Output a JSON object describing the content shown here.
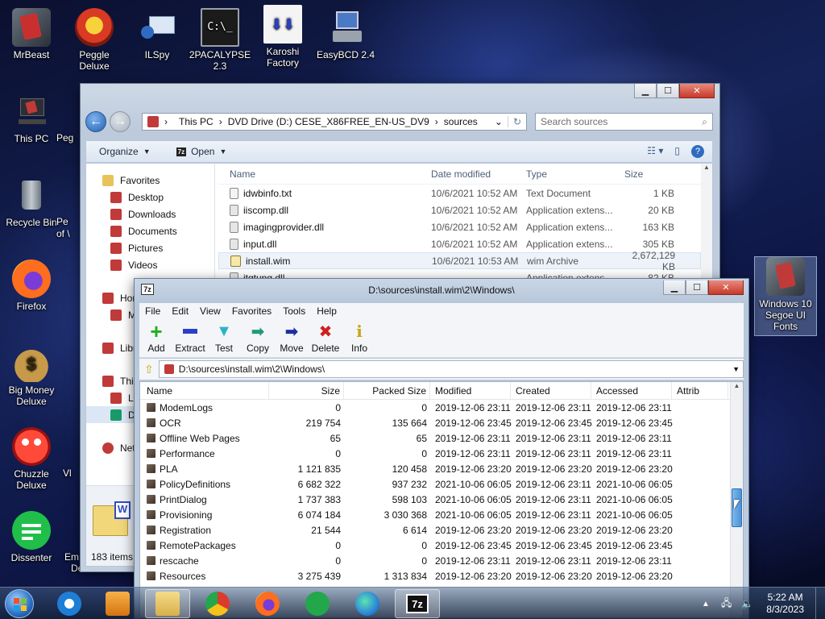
{
  "desktop_icons": [
    {
      "label": "MrBeast",
      "icon": "mrbeast-icon",
      "color": "#c83030"
    },
    {
      "label": "Peggle Deluxe",
      "icon": "peggle-icon",
      "color": "#d93a24"
    },
    {
      "label": "ILSpy",
      "icon": "ilspy-icon",
      "color": "#a9c4e3"
    },
    {
      "label": "2PACALYPSE 2.3",
      "icon": "terminal-icon",
      "color": "#222222"
    },
    {
      "label": "Karoshi Factory",
      "icon": "karoshi-icon",
      "color": "#f2f2f2"
    },
    {
      "label": "EasyBCD 2.4",
      "icon": "easybcd-icon",
      "color": "#4a79c6"
    },
    {
      "label": "This PC",
      "icon": "this-pc-icon",
      "color": "#c03a3a"
    },
    {
      "label": "Recycle Bin",
      "icon": "recycle-bin-icon",
      "color": "#9aa4ad"
    },
    {
      "label": "Firefox",
      "icon": "firefox-icon",
      "color": "#ff6d1f"
    },
    {
      "label": "Big Money Deluxe",
      "icon": "money-bag-icon",
      "color": "#b58a3a"
    },
    {
      "label": "Chuzzle Deluxe",
      "icon": "chuzzle-icon",
      "color": "#d8262a"
    },
    {
      "label": "Dissenter",
      "icon": "dissenter-icon",
      "color": "#1fbf4a"
    },
    {
      "label": "Windows 10 Segoe UI Fonts",
      "icon": "fonts-icon",
      "color": "#c03a3a"
    }
  ],
  "explorer": {
    "breadcrumb": [
      "This PC",
      "DVD Drive (D:) CESE_X86FREE_EN-US_DV9",
      "sources"
    ],
    "search_placeholder": "Search sources",
    "toolbar": {
      "organize": "Organize",
      "open": "Open"
    },
    "nav": {
      "favorites": "Favorites",
      "items": [
        "Desktop",
        "Downloads",
        "Documents",
        "Pictures",
        "Videos"
      ],
      "home_partial": "Hor",
      "m_partial": "M",
      "libraries_partial": "Libr",
      "this_pc_partial": "This",
      "lo_partial": "Lo",
      "d_partial": "D",
      "network_partial": "Net"
    },
    "columns": {
      "name": "Name",
      "date": "Date modified",
      "type": "Type",
      "size": "Size"
    },
    "files": [
      {
        "name": "idwbinfo.txt",
        "date": "10/6/2021 10:52 AM",
        "type": "Text Document",
        "size": "1 KB"
      },
      {
        "name": "iiscomp.dll",
        "date": "10/6/2021 10:52 AM",
        "type": "Application extens...",
        "size": "20 KB"
      },
      {
        "name": "imagingprovider.dll",
        "date": "10/6/2021 10:52 AM",
        "type": "Application extens...",
        "size": "163 KB"
      },
      {
        "name": "input.dll",
        "date": "10/6/2021 10:52 AM",
        "type": "Application extens...",
        "size": "305 KB"
      },
      {
        "name": "install.wim",
        "date": "10/6/2021 10:53 AM",
        "type": "wim Archive",
        "size": "2,672,129 KB"
      },
      {
        "name": "itgtung.dll",
        "date": "",
        "type": "Application extens...",
        "size": "82 KB"
      }
    ],
    "status": "183 items"
  },
  "sevenzip": {
    "title": "D:\\sources\\install.wim\\2\\Windows\\",
    "menu": [
      "File",
      "Edit",
      "View",
      "Favorites",
      "Tools",
      "Help"
    ],
    "toolbar": [
      {
        "label": "Add",
        "icon": "add-icon",
        "color": "#1fae1f"
      },
      {
        "label": "Extract",
        "icon": "extract-icon",
        "color": "#2b3ec9"
      },
      {
        "label": "Test",
        "icon": "test-icon",
        "color": "#28b4c8"
      },
      {
        "label": "Copy",
        "icon": "copy-icon",
        "color": "#1f9a7a"
      },
      {
        "label": "Move",
        "icon": "move-icon",
        "color": "#1e2f9e"
      },
      {
        "label": "Delete",
        "icon": "delete-icon",
        "color": "#d01f1f"
      },
      {
        "label": "Info",
        "icon": "info-icon",
        "color": "#c9a416"
      }
    ],
    "path": "D:\\sources\\install.wim\\2\\Windows\\",
    "columns": {
      "name": "Name",
      "size": "Size",
      "packed": "Packed Size",
      "modified": "Modified",
      "created": "Created",
      "accessed": "Accessed",
      "attrib": "Attrib"
    },
    "rows": [
      {
        "name": "ModemLogs",
        "size": "0",
        "packed": "0",
        "modified": "2019-12-06 23:11",
        "created": "2019-12-06 23:11",
        "accessed": "2019-12-06 23:11"
      },
      {
        "name": "OCR",
        "size": "219 754",
        "packed": "135 664",
        "modified": "2019-12-06 23:45",
        "created": "2019-12-06 23:45",
        "accessed": "2019-12-06 23:45"
      },
      {
        "name": "Offline Web Pages",
        "size": "65",
        "packed": "65",
        "modified": "2019-12-06 23:11",
        "created": "2019-12-06 23:11",
        "accessed": "2019-12-06 23:11"
      },
      {
        "name": "Performance",
        "size": "0",
        "packed": "0",
        "modified": "2019-12-06 23:11",
        "created": "2019-12-06 23:11",
        "accessed": "2019-12-06 23:11"
      },
      {
        "name": "PLA",
        "size": "1 121 835",
        "packed": "120 458",
        "modified": "2019-12-06 23:20",
        "created": "2019-12-06 23:20",
        "accessed": "2019-12-06 23:20"
      },
      {
        "name": "PolicyDefinitions",
        "size": "6 682 322",
        "packed": "937 232",
        "modified": "2021-10-06 06:05",
        "created": "2019-12-06 23:11",
        "accessed": "2021-10-06 06:05"
      },
      {
        "name": "PrintDialog",
        "size": "1 737 383",
        "packed": "598 103",
        "modified": "2021-10-06 06:05",
        "created": "2019-12-06 23:11",
        "accessed": "2021-10-06 06:05"
      },
      {
        "name": "Provisioning",
        "size": "6 074 184",
        "packed": "3 030 368",
        "modified": "2021-10-06 06:05",
        "created": "2019-12-06 23:11",
        "accessed": "2021-10-06 06:05"
      },
      {
        "name": "Registration",
        "size": "21 544",
        "packed": "6 614",
        "modified": "2019-12-06 23:20",
        "created": "2019-12-06 23:20",
        "accessed": "2019-12-06 23:20"
      },
      {
        "name": "RemotePackages",
        "size": "0",
        "packed": "0",
        "modified": "2019-12-06 23:45",
        "created": "2019-12-06 23:45",
        "accessed": "2019-12-06 23:45"
      },
      {
        "name": "rescache",
        "size": "0",
        "packed": "0",
        "modified": "2019-12-06 23:11",
        "created": "2019-12-06 23:11",
        "accessed": "2019-12-06 23:11"
      },
      {
        "name": "Resources",
        "size": "3 275 439",
        "packed": "1 313 834",
        "modified": "2019-12-06 23:20",
        "created": "2019-12-06 23:20",
        "accessed": "2019-12-06 23:20"
      }
    ]
  },
  "taskbar": {
    "apps": [
      {
        "name": "internet-explorer-icon",
        "color": "#1e7ed6"
      },
      {
        "name": "media-player-icon",
        "color": "#e08a1e"
      },
      {
        "name": "file-explorer-icon",
        "color": "#e8c35a"
      },
      {
        "name": "chrome-icon",
        "color": "#db3b2c"
      },
      {
        "name": "firefox-icon",
        "color": "#ff6d1f"
      },
      {
        "name": "sheets-icon",
        "color": "#22a84a"
      },
      {
        "name": "edge-icon",
        "color": "#2c88d9"
      },
      {
        "name": "7zip-icon",
        "color": "#111111"
      }
    ],
    "time": "5:22 AM",
    "date": "8/3/2023"
  },
  "partial_labels": {
    "ghost_1": "Peg",
    "ghost_2": "Pe",
    "ghost_3": "of \\",
    "ghost_4": "Vl",
    "ghost_5": "Em",
    "dev_cpp": "Dev-C++"
  }
}
